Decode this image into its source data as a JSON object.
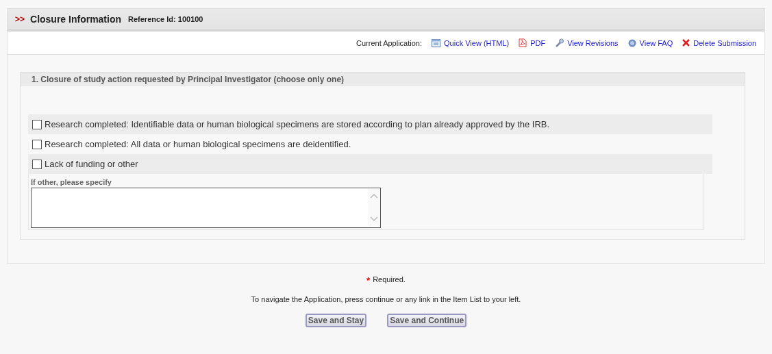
{
  "header": {
    "marker": ">>",
    "title": "Closure Information",
    "reference": "Reference Id: 100100"
  },
  "toolbar": {
    "label": "Current Application:",
    "links": [
      {
        "kind": "list",
        "label": "Quick View (HTML)"
      },
      {
        "kind": "pdf",
        "label": "PDF"
      },
      {
        "kind": "wrench",
        "label": "View Revisions"
      },
      {
        "kind": "help",
        "label": "View FAQ"
      },
      {
        "kind": "delete",
        "label": "Delete Submission"
      }
    ]
  },
  "question": {
    "title": "1.  Closure of study action requested by Principal Investigator (choose only one)",
    "options": [
      {
        "label": "Research completed: Identifiable data or human biological specimens are stored according to plan already approved by the IRB.",
        "checked": false
      },
      {
        "label": "Research completed: All data or human biological specimens are deidentified.",
        "checked": false
      },
      {
        "label": "Lack of funding or other",
        "checked": false
      }
    ],
    "specify_label": "If other, please specify"
  },
  "footer": {
    "required_mark": "*",
    "required": "Required.",
    "hint": "To navigate the Application, press continue or any link in the Item List to your left.",
    "buttons": [
      "Save and Stay",
      "Save and Continue"
    ]
  }
}
